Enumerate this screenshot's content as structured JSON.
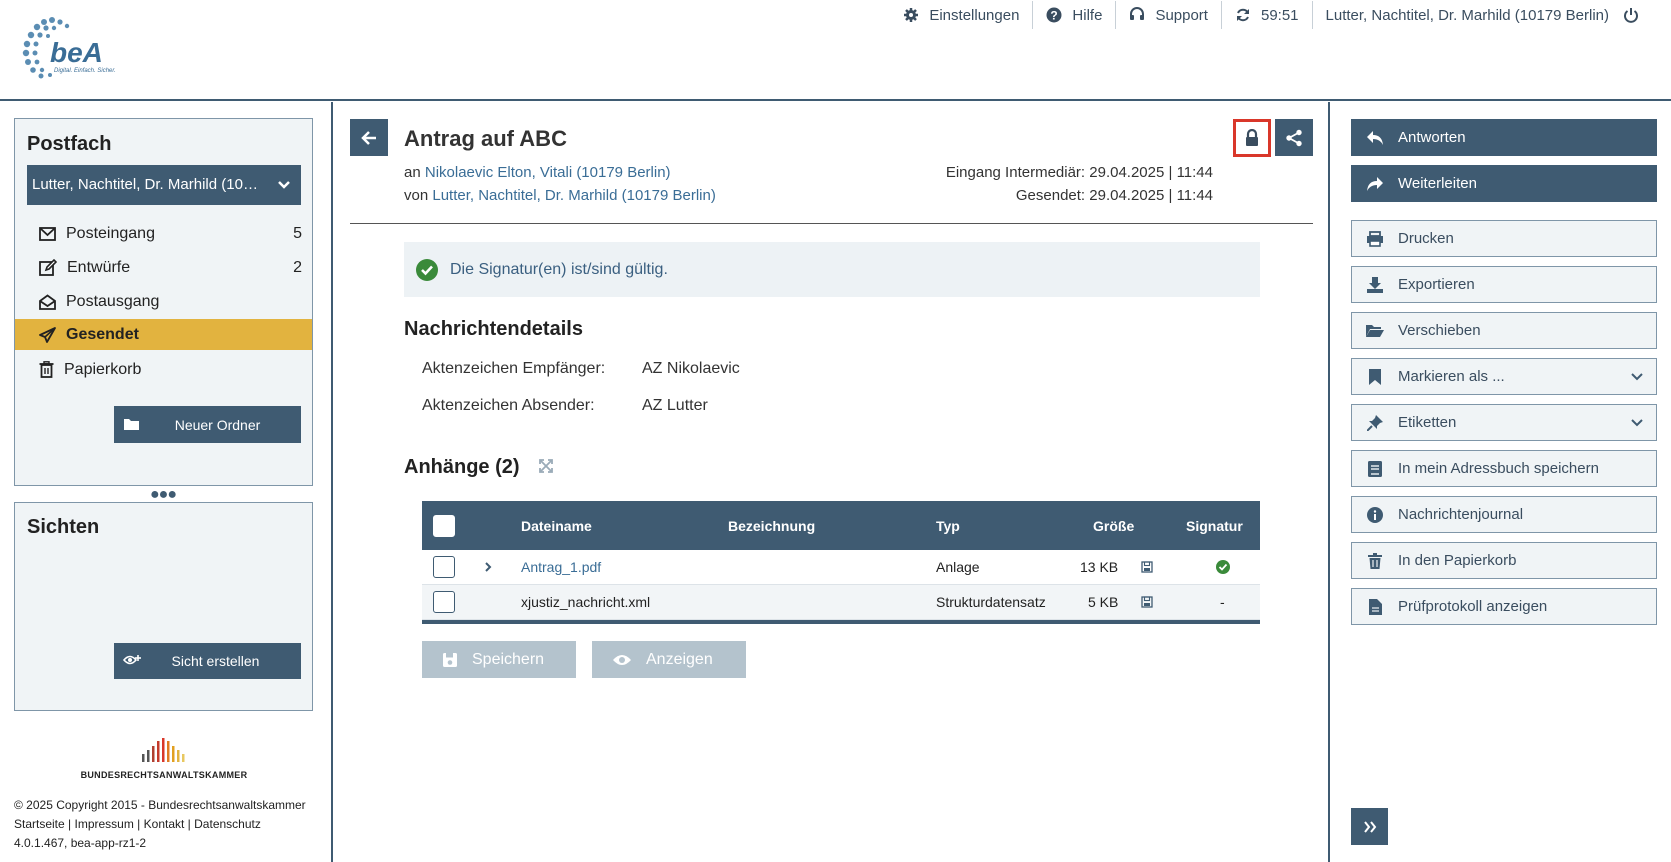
{
  "brand": {
    "logo_text": "beA",
    "tagline": "Digital. Einfach. Sicher."
  },
  "topbar": {
    "settings": "Einstellungen",
    "help": "Hilfe",
    "support": "Support",
    "timer": "59:51",
    "user": "Lutter, Nachtitel, Dr. Marhild (10179 Berlin)"
  },
  "sidebar": {
    "postfach_title": "Postfach",
    "mailbox_selected": "Lutter, Nachtitel, Dr. Marhild (10179 Berlin)",
    "folders": [
      {
        "label": "Posteingang",
        "count": "5",
        "icon": "envelope-icon"
      },
      {
        "label": "Entwürfe",
        "count": "2",
        "icon": "edit-icon"
      },
      {
        "label": "Postausgang",
        "count": "",
        "icon": "envelope-open-icon"
      },
      {
        "label": "Gesendet",
        "count": "",
        "icon": "paper-plane-icon",
        "active": true
      },
      {
        "label": "Papierkorb",
        "count": "",
        "icon": "trash-icon"
      }
    ],
    "new_folder_label": "Neuer Ordner",
    "sichten_title": "Sichten",
    "create_view_label": "Sicht erstellen",
    "brak_name": "BUNDESRECHTSANWALTSKAMMER",
    "footer": {
      "copyright": "© 2025 Copyright 2015 - Bundesrechtsanwaltskammer",
      "links": [
        "Startseite",
        "Impressum",
        "Kontakt",
        "Datenschutz"
      ],
      "version": "4.0.1.467, bea-app-rz1-2"
    }
  },
  "message": {
    "title": "Antrag auf ABC",
    "to_prefix": "an",
    "to": "Nikolaevic Elton, Vitali (10179 Berlin)",
    "from_prefix": "von",
    "from": "Lutter, Nachtitel, Dr. Marhild (10179 Berlin)",
    "received": "Eingang Intermediär: 29.04.2025 | 11:44",
    "sent": "Gesendet: 29.04.2025 | 11:44",
    "signature_status": "Die Signatur(en) ist/sind gültig.",
    "details_title": "Nachrichtendetails",
    "details": [
      {
        "label": "Aktenzeichen Empfänger:",
        "value": "AZ Nikolaevic"
      },
      {
        "label": "Aktenzeichen Absender:",
        "value": "AZ Lutter"
      }
    ],
    "attachments_title": "Anhänge (2)",
    "table": {
      "headers": {
        "filename": "Dateiname",
        "description": "Bezeichnung",
        "type": "Typ",
        "size": "Größe",
        "signature": "Signatur"
      },
      "rows": [
        {
          "filename": "Antrag_1.pdf",
          "description": "",
          "type": "Anlage",
          "size": "13 KB",
          "signature": "valid",
          "expandable": true
        },
        {
          "filename": "xjustiz_nachricht.xml",
          "description": "",
          "type": "Strukturdatensatz",
          "size": "5 KB",
          "signature": "-",
          "expandable": false
        }
      ]
    },
    "save_label": "Speichern",
    "view_label": "Anzeigen"
  },
  "actions": [
    {
      "label": "Antworten",
      "icon": "reply-icon",
      "primary": true
    },
    {
      "label": "Weiterleiten",
      "icon": "forward-icon",
      "primary": true
    },
    {
      "label": "Drucken",
      "icon": "print-icon"
    },
    {
      "label": "Exportieren",
      "icon": "download-icon"
    },
    {
      "label": "Verschieben",
      "icon": "folder-open-icon"
    },
    {
      "label": "Markieren als ...",
      "icon": "bookmark-icon",
      "dropdown": true
    },
    {
      "label": "Etiketten",
      "icon": "pin-icon",
      "dropdown": true
    },
    {
      "label": "In mein Adressbuch speichern",
      "icon": "address-book-icon"
    },
    {
      "label": "Nachrichtenjournal",
      "icon": "info-icon"
    },
    {
      "label": "In den Papierkorb",
      "icon": "trash-icon"
    },
    {
      "label": "Prüfprotokoll anzeigen",
      "icon": "file-icon"
    }
  ],
  "colors": {
    "primary": "#3f5b72",
    "active_folder": "#e2b33f",
    "lock_highlight": "#d9372a",
    "valid": "#3a9a3a"
  }
}
